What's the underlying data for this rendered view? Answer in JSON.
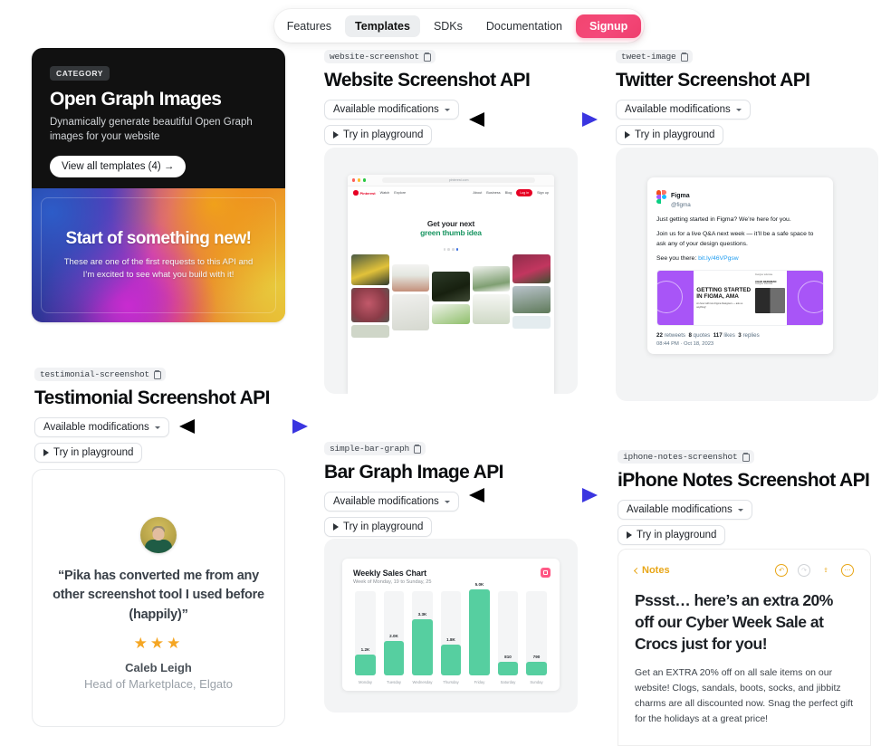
{
  "nav": {
    "items": [
      {
        "label": "Features",
        "state": "default"
      },
      {
        "label": "Templates",
        "state": "active"
      },
      {
        "label": "SDKs",
        "state": "default"
      },
      {
        "label": "Documentation",
        "state": "default"
      },
      {
        "label": "Signup",
        "state": "cta"
      }
    ],
    "cta_color": "#f2456f"
  },
  "og_card": {
    "category_badge": "CATEGORY",
    "title": "Open Graph Images",
    "subtitle": "Dynamically generate beautiful Open Graph images for your website",
    "button": "View all templates (4)  →",
    "preview": {
      "headline": "Start of something new!",
      "description": "These are one of the first requests to this API and I’m excited to see what you build with it!"
    }
  },
  "common": {
    "modifications_label": "Available modifications",
    "playground_label": "Try in playground"
  },
  "sections": [
    {
      "slug": "website-screenshot",
      "title": "Website Screenshot API",
      "has_arrow": true
    },
    {
      "slug": "tweet-image",
      "title": "Twitter Screenshot API",
      "has_arrow": false
    },
    {
      "slug": "testimonial-screenshot",
      "title": "Testimonial Screenshot API",
      "has_arrow": true
    },
    {
      "slug": "simple-bar-graph",
      "title": "Bar Graph Image API",
      "has_arrow": true
    },
    {
      "slug": "iphone-notes-screenshot",
      "title": "iPhone Notes Screenshot API",
      "has_arrow": false
    }
  ],
  "website_preview": {
    "url": "pinterest.com",
    "brand": "Pinterest",
    "nav_left": [
      "Watch",
      "Explore"
    ],
    "nav_right": [
      "About",
      "Business",
      "Blog"
    ],
    "login_label": "Log in",
    "signup_label": "Sign up",
    "hero_line1": "Get your next",
    "hero_line2": "green thumb idea"
  },
  "tweet_preview": {
    "name": "Figma",
    "handle": "@figma",
    "line1": "Just getting started in Figma? We’re here for you.",
    "line2": "Join us for a live Q&A next week — it’ll be a safe space to ask any of your design questions.",
    "line3_prefix": "See you there: ",
    "link": "bit.ly/46VPgsw",
    "image_text": "GETTING STARTED IN FIGMA, AMA",
    "image_caption": "An hour with two Figma Designers — ask us anything!",
    "image_name": "CHAD BERGMAN",
    "image_role": "Designer advocate",
    "stats": [
      {
        "count": "22",
        "label": "retweets"
      },
      {
        "count": "8",
        "label": "quotes"
      },
      {
        "count": "117",
        "label": "likes"
      },
      {
        "count": "3",
        "label": "replies"
      }
    ],
    "timestamp": "08:44 PM · Oct 18, 2023"
  },
  "testimonial_preview": {
    "quote": "“Pika has converted me from any other screenshot tool I used before (happily)”",
    "stars": "★★★",
    "star_count": 3,
    "name": "Caleb Leigh",
    "role": "Head of Marketplace, Elgato"
  },
  "notes_preview": {
    "back_label": "Notes",
    "title": "Pssst… here’s an extra 20% off our Cyber Week Sale at Crocs just for you!",
    "body": "Get an EXTRA 20% off on all sale items on our website! Clogs, sandals, boots, socks, and jibbitz charms are all discounted now. Snag the perfect gift for the holidays at a great price!",
    "icons": [
      "undo-icon",
      "redo-icon",
      "share-icon",
      "more-icon"
    ]
  },
  "chart_data": {
    "type": "bar",
    "title": "Weekly Sales Chart",
    "subtitle": "Week of Monday, 19 to Sunday, 25",
    "categories": [
      "Monday",
      "Tuesday",
      "Wednesday",
      "Thursday",
      "Friday",
      "Saturday",
      "Sunday"
    ],
    "values": [
      1200,
      2000,
      3300,
      1800,
      5000,
      810,
      790
    ],
    "value_labels": [
      "1.2K",
      "2.0K",
      "3.3K",
      "1.8K",
      "5.0K",
      "810",
      "790"
    ],
    "bar_color": "#56cfa0",
    "track_color": "#f4f5f6",
    "ylim": [
      0,
      5600
    ],
    "xlabel": "",
    "ylabel": "",
    "grid": false,
    "legend": "none"
  }
}
